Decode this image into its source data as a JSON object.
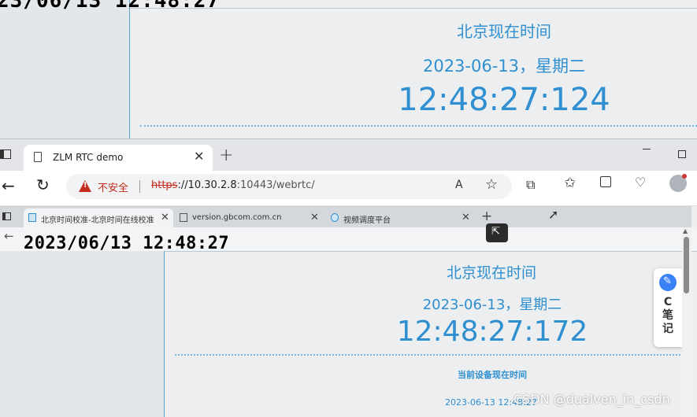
{
  "background_capture": {
    "timestamp": "23/06/13 12:48:27",
    "clock": {
      "title": "北京现在时间",
      "date": "2023-06-13，星期二",
      "time": "12:48:27:124"
    }
  },
  "browser": {
    "tab": {
      "title": "ZLM RTC demo",
      "close_label": "✕",
      "tab_icon": "page-icon"
    },
    "new_tab_label": "+",
    "window": {
      "minimize": "minimize-icon",
      "maximize": "maximize-icon"
    },
    "toolbar": {
      "back_label": "←",
      "refresh_label": "↻",
      "security_warning": "不安全",
      "url": {
        "scheme": "https",
        "rest": "://10.30.2.8",
        "port_path": ":10443/webrtc/"
      },
      "read_aloud_label": "A",
      "favorite_label": "☆",
      "extensions_label": "⧉",
      "favorites_bar_label": "✩",
      "health_label": "♡"
    },
    "accent_color": "#c42b1c"
  },
  "inner_capture": {
    "tabs": [
      {
        "title": "北京时间校准-北京时间在线校准",
        "close": "✕"
      },
      {
        "title": "version.gbcom.com.cn",
        "close": "✕"
      },
      {
        "title": "视频调度平台",
        "close": "✕"
      }
    ],
    "new_tab_label": "+",
    "back_label": "←",
    "timestamp": "2023/06/13 12:48:27",
    "clock": {
      "title": "北京现在时间",
      "date": "2023-06-13，星期二",
      "time": "12:48:27:172"
    },
    "device_time_label": "当前设备现在时间",
    "device_time_value": "2023-06-13 12:48:27",
    "share_label": "⇱",
    "side_note": {
      "icon": "✎",
      "text": "C 笔 记"
    },
    "scroll_up": "▲",
    "clock_color": "#2f8fd0"
  },
  "watermark": "CSDN @dualven_in_csdn"
}
